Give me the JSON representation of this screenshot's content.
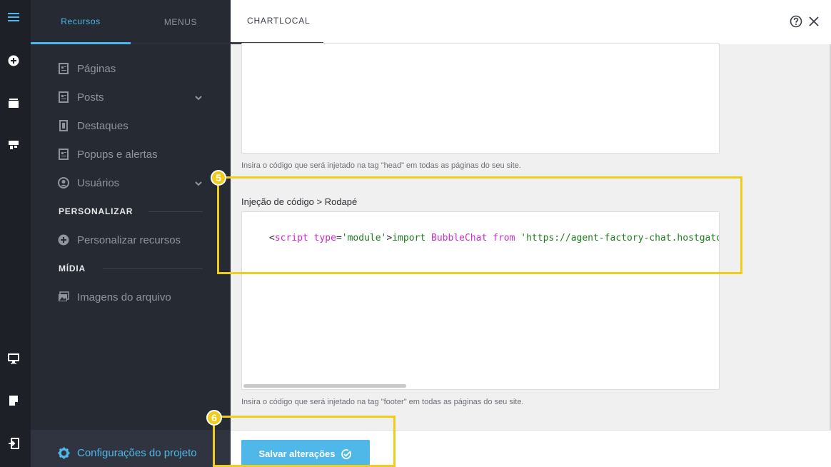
{
  "sidebar": {
    "tabs": [
      "Recursos",
      "MENUS"
    ],
    "items": [
      {
        "label": "Páginas",
        "icon": "page-icon"
      },
      {
        "label": "Posts",
        "icon": "page-icon",
        "has_submenu": true
      },
      {
        "label": "Destaques",
        "icon": "bookmark-icon"
      },
      {
        "label": "Popups e alertas",
        "icon": "page-icon"
      },
      {
        "label": "Usuários",
        "icon": "user-icon",
        "has_submenu": true
      }
    ],
    "section_personalizar": "PERSONALIZAR",
    "personalizar_item": "Personalizar recursos",
    "section_midia": "MÍDIA",
    "midia_item": "Imagens do arquivo",
    "footer_label": "Configurações do projeto"
  },
  "topbar": {
    "tab": "CHARTLOCAL"
  },
  "main": {
    "head_hint": "Insira o código que será injetado na tag \"head\" em todas as páginas do seu site.",
    "footer_label": "Injeção de código > Rodapé",
    "footer_code": {
      "open": "<",
      "el": "script",
      "attr": "type",
      "eq": "=",
      "attr_val": "'module'",
      "close": ">",
      "kw_import": "import",
      "name": "BubbleChat",
      "kw_from": "from",
      "url": "'https://agent-factory-chat.hostgator"
    },
    "footer_hint": "Insira o código que será injetado na tag \"footer\" em todas as páginas do seu site."
  },
  "bottombar": {
    "save_label": "Salvar alterações"
  },
  "annotations": {
    "step5": "5",
    "step6": "6"
  },
  "colors": {
    "accent": "#4fb8e8",
    "highlight": "#f2cc1a",
    "rail": "#1d2027",
    "sidebar": "#262a33"
  }
}
